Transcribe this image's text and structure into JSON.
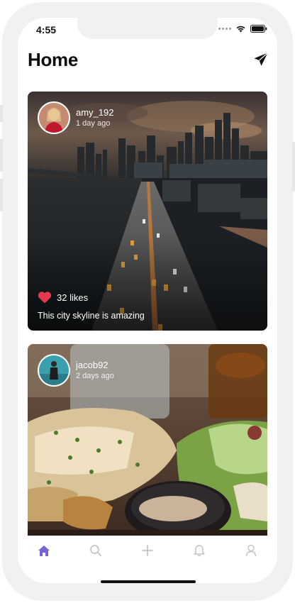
{
  "status_bar": {
    "time": "4:55"
  },
  "header": {
    "title": "Home"
  },
  "posts": [
    {
      "username": "amy_192",
      "time_ago": "1 day ago",
      "likes": "32 likes",
      "caption": "This city skyline is amazing"
    },
    {
      "username": "jacob92",
      "time_ago": "2 days ago"
    }
  ],
  "tab_bar": {
    "items": [
      "home-icon",
      "search-icon",
      "plus-icon",
      "bell-icon",
      "profile-icon"
    ],
    "active": "home-icon"
  },
  "colors": {
    "accent": "#7b61d8",
    "heart": "#e53950",
    "tab_inactive": "#c4c4c4"
  }
}
